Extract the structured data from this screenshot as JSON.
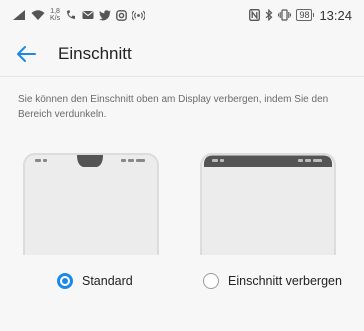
{
  "status_bar": {
    "speed_value": "1,8",
    "speed_unit": "K/s",
    "battery": "98",
    "time": "13:24"
  },
  "header": {
    "back_icon": "arrow-left-icon",
    "title": "Einschnitt"
  },
  "description": "Sie können den Einschnitt oben am Display verbergen, indem Sie den Bereich verdunkeln.",
  "options": [
    {
      "label": "Standard",
      "selected": true
    },
    {
      "label": "Einschnitt verbergen",
      "selected": false
    }
  ],
  "colors": {
    "accent": "#1e88e5",
    "notch": "#545454"
  }
}
